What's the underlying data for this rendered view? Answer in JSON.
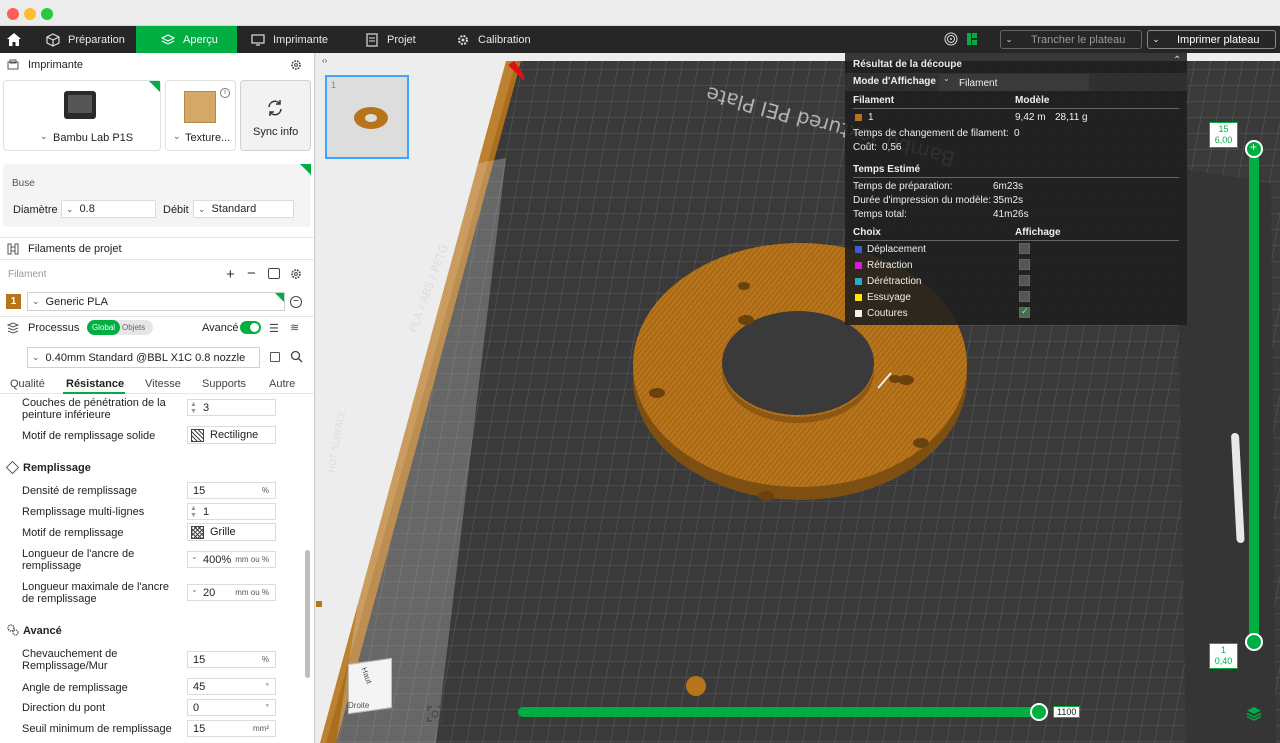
{
  "topbar": {
    "tabs": [
      {
        "label": "Préparation"
      },
      {
        "label": "Aperçu"
      },
      {
        "label": "Imprimante"
      },
      {
        "label": "Projet"
      },
      {
        "label": "Calibration"
      }
    ],
    "slice_button": "Trancher le plateau",
    "print_button": "Imprimer plateau"
  },
  "printer": {
    "header": "Imprimante",
    "printer_name": "Bambu Lab P1S",
    "plate_name": "Texture...",
    "sync_label": "Sync info"
  },
  "nozzle": {
    "header": "Buse",
    "diameter_label": "Diamètre",
    "diameter_value": "0.8",
    "flow_label": "Débit",
    "flow_value": "Standard"
  },
  "filaments": {
    "header": "Filaments de projet",
    "sub_label": "Filament",
    "slot_number": "1",
    "filament_name": "Generic PLA"
  },
  "process": {
    "label": "Processus",
    "toggle_global": "Global",
    "toggle_objects": "Objets",
    "advanced_label": "Avancé",
    "profile": "0.40mm Standard @BBL X1C 0.8 nozzle",
    "tabs": [
      "Qualité",
      "Résistance",
      "Vitesse",
      "Supports",
      "Autre"
    ],
    "rows_top": [
      {
        "label": "Couches de pénétration de la peinture inférieure",
        "value": "3"
      },
      {
        "label": "Motif de remplissage solide",
        "value": "Rectiligne"
      }
    ],
    "infill_header": "Remplissage",
    "infill_rows": [
      {
        "label": "Densité de remplissage",
        "value": "15",
        "unit": "%"
      },
      {
        "label": "Remplissage multi-lignes",
        "value": "1",
        "unit": ""
      },
      {
        "label": "Motif de remplissage",
        "value": "Grille",
        "unit": ""
      },
      {
        "label": "Longueur de l'ancre de remplissage",
        "value": "400%",
        "unit": "mm ou %"
      },
      {
        "label": "Longueur maximale de l'ancre de remplissage",
        "value": "20",
        "unit": "mm ou %"
      }
    ],
    "advanced_header": "Avancé",
    "advanced_rows": [
      {
        "label": "Chevauchement de Remplissage/Mur",
        "value": "15",
        "unit": "%"
      },
      {
        "label": "Angle de remplissage",
        "value": "45",
        "unit": "°"
      },
      {
        "label": "Direction du pont",
        "value": "0",
        "unit": "°"
      },
      {
        "label": "Seuil minimum de remplissage",
        "value": "15",
        "unit": "mm²"
      }
    ]
  },
  "plate_thumb": {
    "index": "1"
  },
  "result": {
    "title": "Résultat de la découpe",
    "display_mode_label": "Mode d'Affichage",
    "display_mode_value": "Filament",
    "col_filament": "Filament",
    "col_model": "Modèle",
    "filament_index": "1",
    "filament_length": "9,42 m",
    "filament_weight": "28,11 g",
    "change_time_label": "Temps de changement de filament:",
    "change_time_value": "0",
    "cost_label": "Coût:",
    "cost_value": "0,56",
    "time_header": "Temps Estimé",
    "prep_label": "Temps de préparation:",
    "prep_value": "6m23s",
    "model_time_label": "Durée d'impression du modèle:",
    "model_time_value": "35m2s",
    "total_label": "Temps total:",
    "total_value": "41m26s",
    "choice_header": "Choix",
    "display_header": "Affichage",
    "choices": [
      {
        "label": "Déplacement",
        "color": "#3a5fcd"
      },
      {
        "label": "Rétraction",
        "color": "#d81bd8"
      },
      {
        "label": "Dérétraction",
        "color": "#29a8d8"
      },
      {
        "label": "Essuyage",
        "color": "#ffe600"
      },
      {
        "label": "Coutures",
        "color": "#f2f2f2"
      }
    ]
  },
  "layer_slider": {
    "top_layer": "15",
    "top_height": "6,00",
    "bottom_layer": "1",
    "bottom_height": "0,40"
  },
  "move_slider": {
    "value": "1100"
  },
  "bed": {
    "brand_text": "Bambu Textured PEI Plate",
    "material_text": "PLA / ABS / PETG",
    "hot_text": "HOT SURFACE"
  },
  "cube": {
    "top": "Haut",
    "right": "Droite"
  },
  "colors": {
    "accent": "#00ae42",
    "filament": "#b8741a"
  }
}
